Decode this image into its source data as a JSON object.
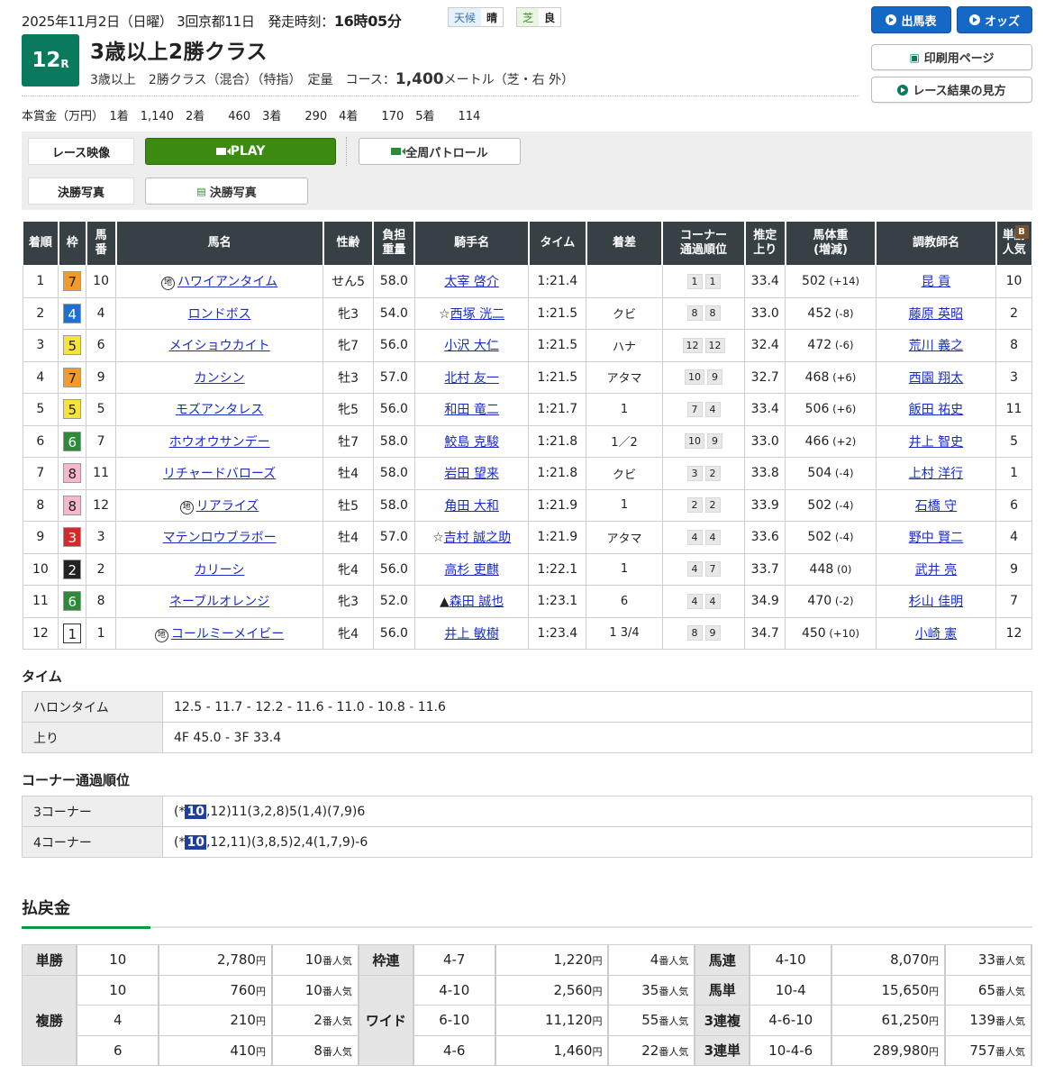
{
  "header": {
    "date": "2025年11月2日（日曜） 3回京都11日",
    "post_label": "発走時刻：",
    "post_time": "16時05分",
    "weather_label": "天候",
    "weather": "晴",
    "track_label": "芝",
    "track_cond": "良",
    "race_num": "12",
    "race_r": "R",
    "title": "3歳以上2勝クラス",
    "conditions": "3歳以上　2勝クラス（混合）（特指）　定量",
    "course_label": "コース：",
    "distance": "1,400",
    "course_tail": "メートル（芝・右 外）",
    "prize": "本賞金（万円）　1着　1,140　2着　　460　3着　　290　4着　　170　5着　　114"
  },
  "buttons": {
    "entries": "出馬表",
    "odds": "オッズ",
    "print": "印刷用ページ",
    "howto": "レース結果の見方"
  },
  "media": {
    "video_label": "レース映像",
    "play": "PLAY",
    "patrol": "全周パトロール",
    "photo_label": "決勝写真",
    "photo_btn": "決勝写真"
  },
  "columns": [
    "着順",
    "枠",
    "馬番",
    "馬名",
    "性齢",
    "負担重量",
    "騎手名",
    "タイム",
    "着差",
    "コーナー通過順位",
    "推定上り",
    "馬体重(増減)",
    "調教師名",
    "単勝人気"
  ],
  "col_html": [
    "着順",
    "枠",
    "馬\n番",
    "馬名",
    "性齢",
    "負担\n重量",
    "騎手名",
    "タイム",
    "着差",
    "コーナー\n通過順位",
    "推定\n上り",
    "馬体重\n(増減)",
    "調教師名",
    "単勝\n人気"
  ],
  "results": [
    {
      "pos": "1",
      "waku": "7",
      "num": "10",
      "chi": true,
      "name": "ハワイアンタイム",
      "blinker": true,
      "sex": "せん5",
      "wt": "58.0",
      "jockey": "太宰 啓介",
      "mark": "",
      "time": "1:21.4",
      "margin": "",
      "c3": "1",
      "c4": "1",
      "last": "33.4",
      "bw": "502",
      "bwd": "(+14)",
      "trainer": "昆 貢",
      "pop": "10"
    },
    {
      "pos": "2",
      "waku": "4",
      "num": "4",
      "chi": false,
      "name": "ロンドボス",
      "blinker": false,
      "sex": "牝3",
      "wt": "54.0",
      "jockey": "西塚 洸二",
      "mark": "☆",
      "time": "1:21.5",
      "margin": "クビ",
      "c3": "8",
      "c4": "8",
      "last": "33.0",
      "bw": "452",
      "bwd": "(-8)",
      "trainer": "藤原 英昭",
      "pop": "2"
    },
    {
      "pos": "3",
      "waku": "5",
      "num": "6",
      "chi": false,
      "name": "メイショウカイト",
      "blinker": false,
      "sex": "牝7",
      "wt": "56.0",
      "jockey": "小沢 大仁",
      "mark": "",
      "time": "1:21.5",
      "margin": "ハナ",
      "c3": "12",
      "c4": "12",
      "last": "32.4",
      "bw": "472",
      "bwd": "(-6)",
      "trainer": "荒川 義之",
      "pop": "8"
    },
    {
      "pos": "4",
      "waku": "7",
      "num": "9",
      "chi": false,
      "name": "カンシン",
      "blinker": false,
      "sex": "牡3",
      "wt": "57.0",
      "jockey": "北村 友一",
      "mark": "",
      "time": "1:21.5",
      "margin": "アタマ",
      "c3": "10",
      "c4": "9",
      "last": "32.7",
      "bw": "468",
      "bwd": "(+6)",
      "trainer": "西園 翔太",
      "pop": "3"
    },
    {
      "pos": "5",
      "waku": "5",
      "num": "5",
      "chi": false,
      "name": "モズアンタレス",
      "blinker": false,
      "sex": "牝5",
      "wt": "56.0",
      "jockey": "和田 竜二",
      "mark": "",
      "time": "1:21.7",
      "margin": "1",
      "c3": "7",
      "c4": "4",
      "last": "33.4",
      "bw": "506",
      "bwd": "(+6)",
      "trainer": "飯田 祐史",
      "pop": "11"
    },
    {
      "pos": "6",
      "waku": "6",
      "num": "7",
      "chi": false,
      "name": "ホウオウサンデー",
      "blinker": false,
      "sex": "牡7",
      "wt": "58.0",
      "jockey": "鮫島 克駿",
      "mark": "",
      "time": "1:21.8",
      "margin": "1／2",
      "c3": "10",
      "c4": "9",
      "last": "33.0",
      "bw": "466",
      "bwd": "(+2)",
      "trainer": "井上 智史",
      "pop": "5"
    },
    {
      "pos": "7",
      "waku": "8",
      "num": "11",
      "chi": false,
      "name": "リチャードバローズ",
      "blinker": false,
      "sex": "牡4",
      "wt": "58.0",
      "jockey": "岩田 望来",
      "mark": "",
      "time": "1:21.8",
      "margin": "クビ",
      "c3": "3",
      "c4": "2",
      "last": "33.8",
      "bw": "504",
      "bwd": "(-4)",
      "trainer": "上村 洋行",
      "pop": "1"
    },
    {
      "pos": "8",
      "waku": "8",
      "num": "12",
      "chi": true,
      "name": "リアライズ",
      "blinker": false,
      "sex": "牡5",
      "wt": "58.0",
      "jockey": "角田 大和",
      "mark": "",
      "time": "1:21.9",
      "margin": "1",
      "c3": "2",
      "c4": "2",
      "last": "33.9",
      "bw": "502",
      "bwd": "(-4)",
      "trainer": "石橋 守",
      "pop": "6"
    },
    {
      "pos": "9",
      "waku": "3",
      "num": "3",
      "chi": false,
      "name": "マテンロウブラボー",
      "blinker": false,
      "sex": "牡4",
      "wt": "57.0",
      "jockey": "吉村 誠之助",
      "mark": "☆",
      "time": "1:21.9",
      "margin": "アタマ",
      "c3": "4",
      "c4": "4",
      "last": "33.6",
      "bw": "502",
      "bwd": "(-4)",
      "trainer": "野中 賢二",
      "pop": "4"
    },
    {
      "pos": "10",
      "waku": "2",
      "num": "2",
      "chi": false,
      "name": "カリーシ",
      "blinker": false,
      "sex": "牝4",
      "wt": "56.0",
      "jockey": "高杉 吏麒",
      "mark": "",
      "time": "1:22.1",
      "margin": "1",
      "c3": "4",
      "c4": "7",
      "last": "33.7",
      "bw": "448",
      "bwd": "(0)",
      "trainer": "武井 亮",
      "pop": "9"
    },
    {
      "pos": "11",
      "waku": "6",
      "num": "8",
      "chi": false,
      "name": "ネーブルオレンジ",
      "blinker": true,
      "sex": "牝3",
      "wt": "52.0",
      "jockey": "森田 誠也",
      "mark": "▲",
      "time": "1:23.1",
      "margin": "6",
      "c3": "4",
      "c4": "4",
      "last": "34.9",
      "bw": "470",
      "bwd": "(-2)",
      "trainer": "杉山 佳明",
      "pop": "7"
    },
    {
      "pos": "12",
      "waku": "1",
      "num": "1",
      "chi": true,
      "name": "コールミーメイビー",
      "blinker": false,
      "sex": "牝4",
      "wt": "56.0",
      "jockey": "井上 敏樹",
      "mark": "",
      "time": "1:23.4",
      "margin": "1 3/4",
      "c3": "8",
      "c4": "9",
      "last": "34.7",
      "bw": "450",
      "bwd": "(+10)",
      "trainer": "小崎 憲",
      "pop": "12"
    }
  ],
  "chi_mark": "地",
  "blinker_mark": "B",
  "waku_colors": {
    "1": "#ffffff",
    "2": "#222222",
    "3": "#d42a2a",
    "4": "#1f6fd0",
    "5": "#f6e43a",
    "6": "#2c8a3a",
    "7": "#f39a2b",
    "8": "#f6b8cd"
  },
  "time_section": {
    "title": "タイム",
    "furlong_label": "ハロンタイム",
    "furlong": "12.5 - 11.7 - 12.2 - 11.6 - 11.0 - 10.8 - 11.6",
    "last_label": "上り",
    "last": "4F 45.0 - 3F 33.4"
  },
  "corner_section": {
    "title": "コーナー通過順位",
    "c3_label": "3コーナー",
    "c3_pre": "(*",
    "c3_hl": "10",
    "c3_rest": ",12)11(3,2,8)5(1,4)(7,9)6",
    "c4_label": "4コーナー",
    "c4_pre": "(*",
    "c4_hl": "10",
    "c4_rest": ",12,11)(3,8,5)2,4(1,7,9)-6"
  },
  "payout": {
    "title": "払戻金",
    "yen": "円",
    "pop": "番人気",
    "tansho": {
      "label": "単勝",
      "rows": [
        {
          "n": "10",
          "amt": "2,780",
          "p": "10"
        }
      ]
    },
    "fukusho": {
      "label": "複勝",
      "rows": [
        {
          "n": "10",
          "amt": "760",
          "p": "10"
        },
        {
          "n": "4",
          "amt": "210",
          "p": "2"
        },
        {
          "n": "6",
          "amt": "410",
          "p": "8"
        }
      ]
    },
    "wakuren": {
      "label": "枠連",
      "rows": [
        {
          "n": "4-7",
          "amt": "1,220",
          "p": "4"
        }
      ]
    },
    "wide": {
      "label": "ワイド",
      "rows": [
        {
          "n": "4-10",
          "amt": "2,560",
          "p": "35"
        },
        {
          "n": "6-10",
          "amt": "11,120",
          "p": "55"
        },
        {
          "n": "4-6",
          "amt": "1,460",
          "p": "22"
        }
      ]
    },
    "umaren": {
      "label": "馬連",
      "rows": [
        {
          "n": "4-10",
          "amt": "8,070",
          "p": "33"
        }
      ]
    },
    "umatan": {
      "label": "馬単",
      "rows": [
        {
          "n": "10-4",
          "amt": "15,650",
          "p": "65"
        }
      ]
    },
    "sanrenpuku": {
      "label": "3連複",
      "rows": [
        {
          "n": "4-6-10",
          "amt": "61,250",
          "p": "139"
        }
      ]
    },
    "sanrentan": {
      "label": "3連単",
      "rows": [
        {
          "n": "10-4-6",
          "amt": "289,980",
          "p": "757"
        }
      ]
    }
  }
}
